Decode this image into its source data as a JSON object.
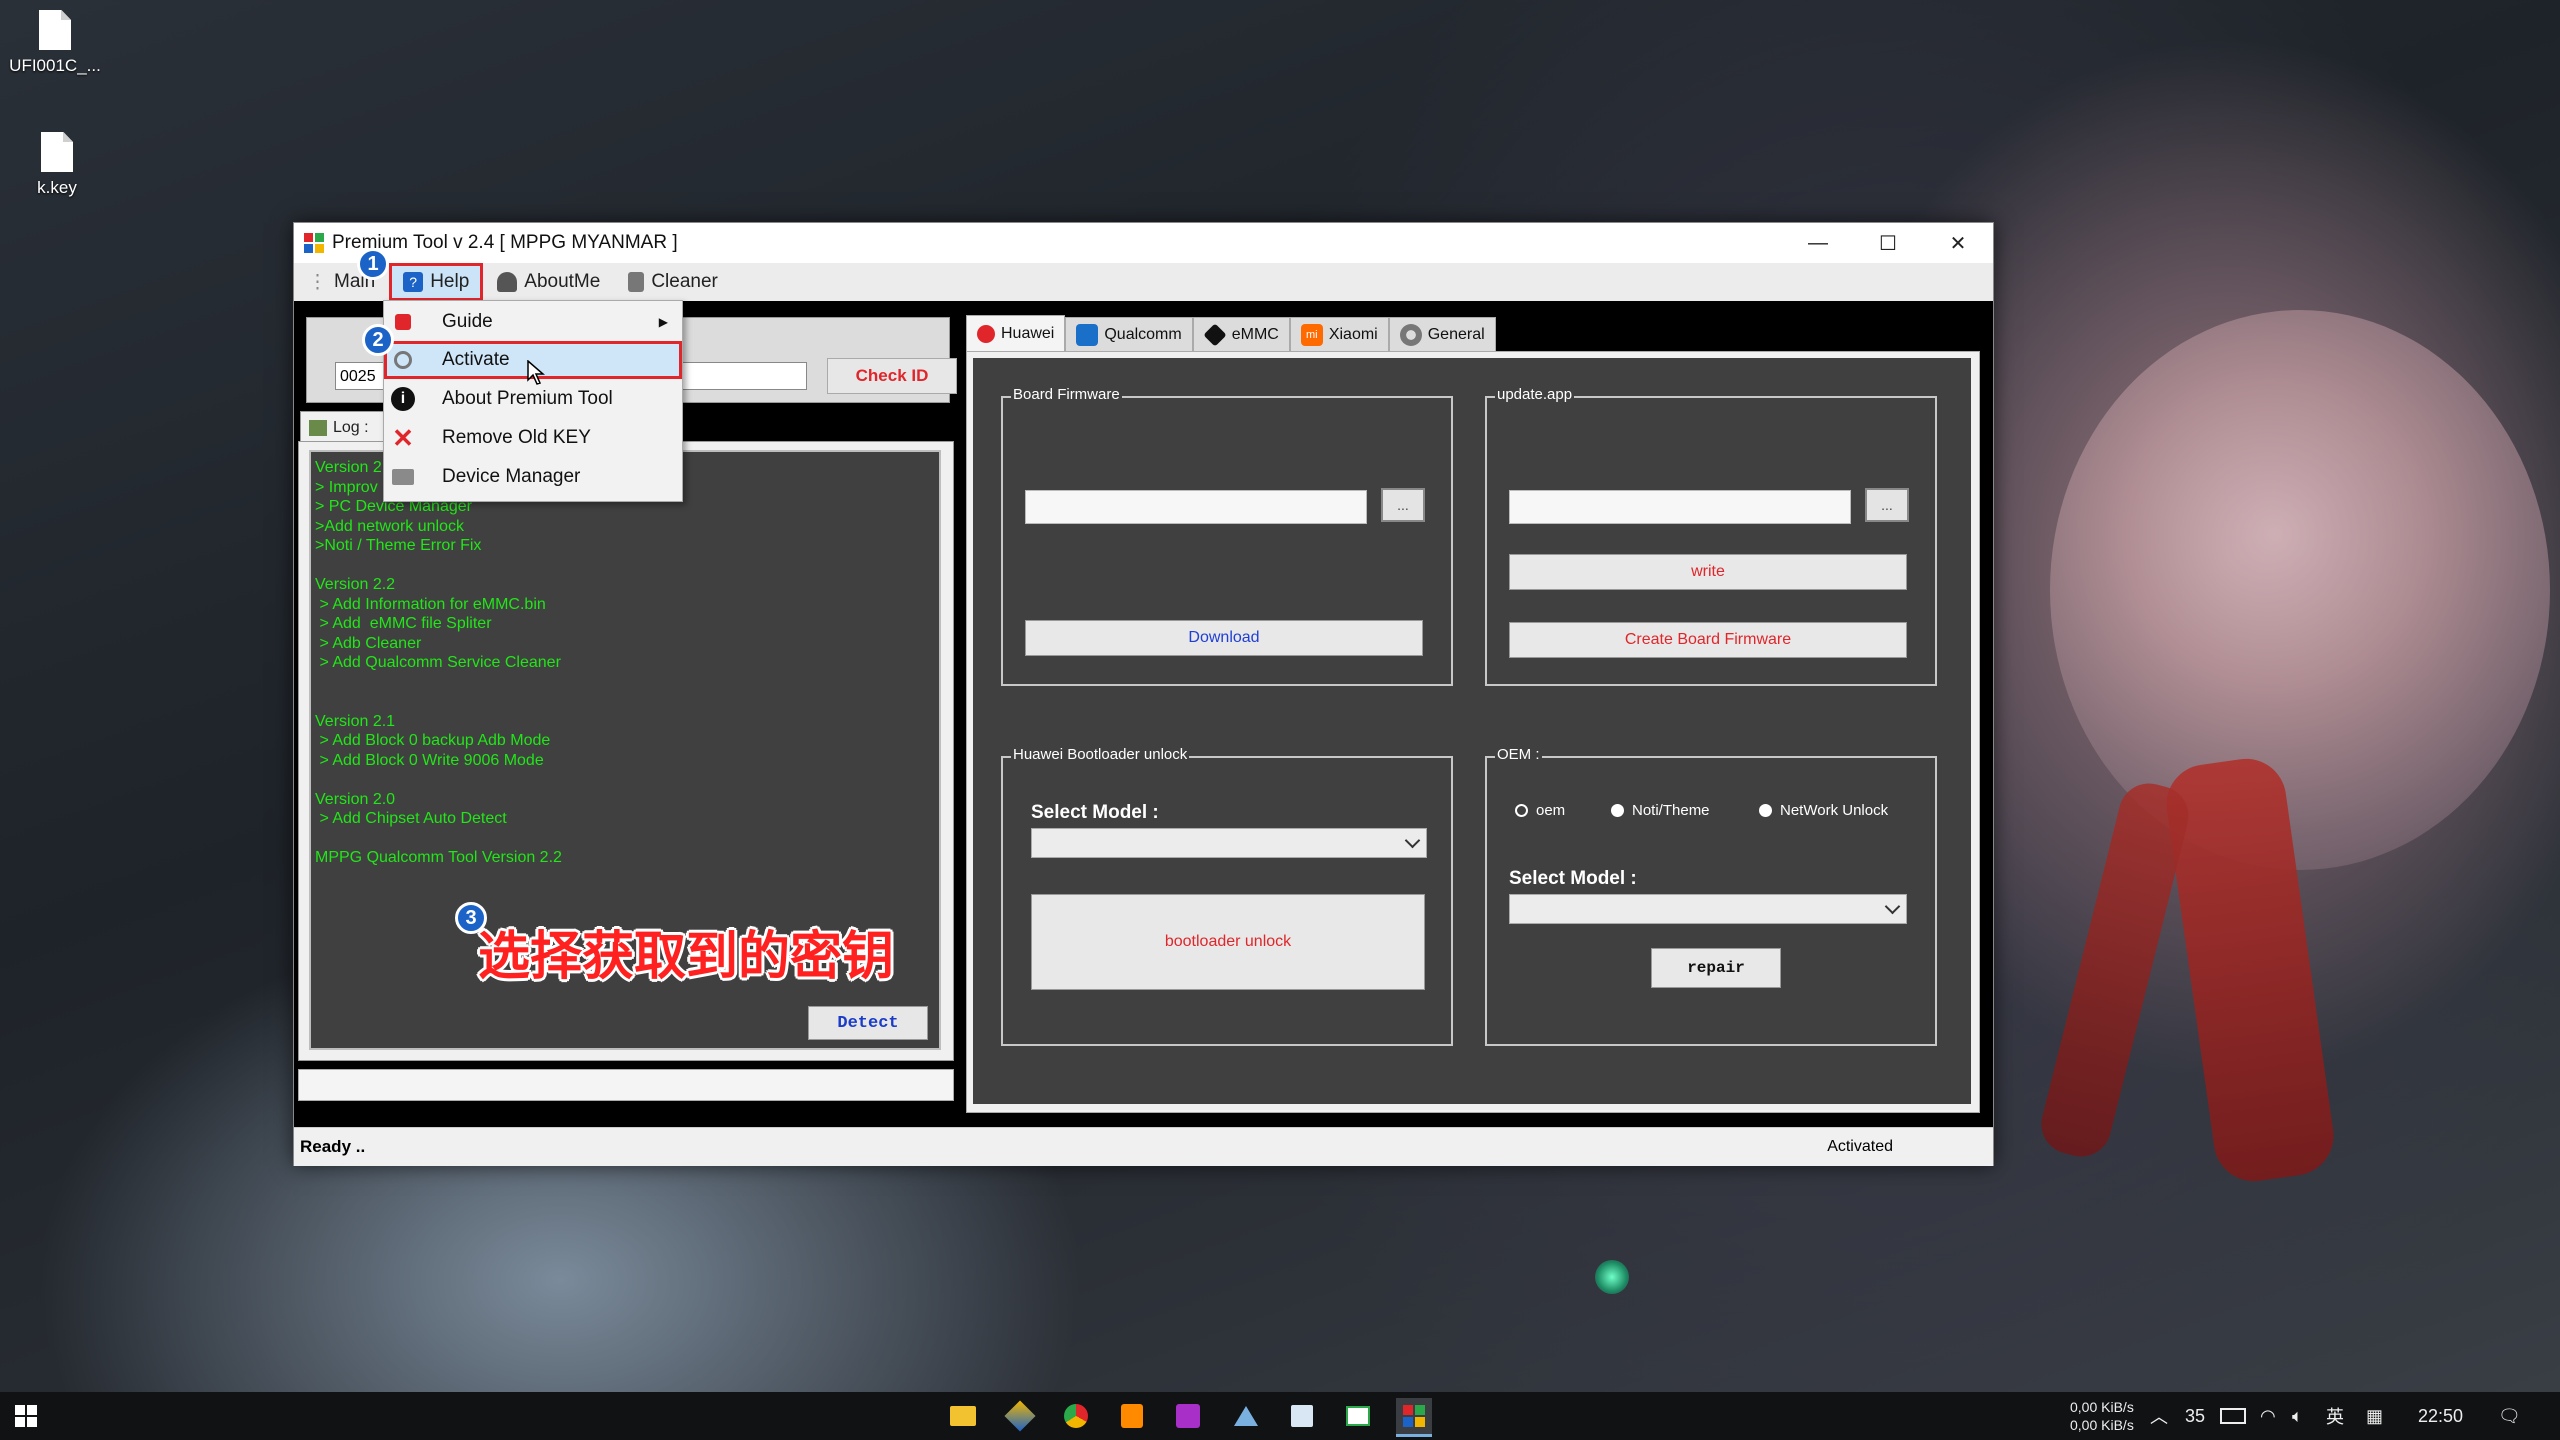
{
  "desktop": {
    "icons": [
      {
        "label": "UFI001C_...",
        "icon": "file-icon"
      },
      {
        "label": "k.key",
        "icon": "file-icon"
      }
    ]
  },
  "window": {
    "title": "Premium Tool v 2.4  [ MPPG MYANMAR ]",
    "controls": {
      "minimize": "—",
      "maximize": "☐",
      "close": "✕"
    }
  },
  "menubar": {
    "main": "Main",
    "help": "Help",
    "aboutme": "AboutMe",
    "cleaner": "Cleaner"
  },
  "help_menu": {
    "items": [
      {
        "label": "Guide",
        "icon": "book-icon",
        "has_submenu": true
      },
      {
        "label": "Activate",
        "icon": "power-icon",
        "selected": true
      },
      {
        "label": "About Premium Tool",
        "icon": "info-icon"
      },
      {
        "label": "Remove Old KEY",
        "icon": "x-icon"
      },
      {
        "label": "Device Manager",
        "icon": "device-manager-icon"
      }
    ]
  },
  "left_panel": {
    "id_value": "0025",
    "check_id_label": "Check ID",
    "log_tab_label": "Log :",
    "log_lines": [
      "Version 2",
      "> Improv",
      "> PC Device Manager",
      ">Add network unlock",
      ">Noti / Theme Error Fix",
      "",
      "Version 2.2",
      " > Add Information for eMMC.bin",
      " > Add  eMMC file Spliter",
      " > Adb Cleaner",
      " > Add Qualcomm Service Cleaner",
      "",
      "",
      "Version 2.1",
      " > Add Block 0 backup Adb Mode",
      " > Add Block 0 Write 9006 Mode",
      "",
      "Version 2.0",
      " > Add Chipset Auto Detect",
      "",
      "MPPG Qualcomm Tool Version 2.2"
    ],
    "detect_label": "Detect"
  },
  "tabs": [
    {
      "label": "Huawei",
      "active": true,
      "color": "#e0262b"
    },
    {
      "label": "Qualcomm",
      "active": false,
      "color": "#1a6fc9"
    },
    {
      "label": "eMMC",
      "active": false,
      "color": "#111111"
    },
    {
      "label": "Xiaomi",
      "active": false,
      "color": "#ff6a00"
    },
    {
      "label": "General",
      "active": false,
      "color": "#777777"
    }
  ],
  "huawei": {
    "board_firmware": {
      "title": "Board Firmware",
      "browse": "...",
      "download_label": "Download"
    },
    "update_app": {
      "title": "update.app",
      "browse": "...",
      "write_label": "write",
      "create_label": "Create Board Firmware"
    },
    "bootloader": {
      "title": "Huawei Bootloader unlock",
      "select_model_label": "Select Model :",
      "unlock_label": "bootloader unlock"
    },
    "oem": {
      "title": "OEM :",
      "radios": [
        "oem",
        "Noti/Theme",
        "NetWork Unlock"
      ],
      "select_model_label": "Select Model :",
      "repair_label": "repair"
    }
  },
  "statusbar": {
    "left": "Ready ..",
    "right": "Activated"
  },
  "annotations": {
    "steps": [
      "1",
      "2",
      "3"
    ],
    "caption": "选择获取到的密钥"
  },
  "taskbar": {
    "net_up": "0,00 KiB/s",
    "net_down": "0,00 KiB/s",
    "temp": "35",
    "ime": "英",
    "time": "22:50"
  },
  "colors": {
    "accent_red": "#e0262b",
    "log_green": "#21e617",
    "panel_dark": "#404040",
    "badge_blue": "#1c63c7"
  }
}
